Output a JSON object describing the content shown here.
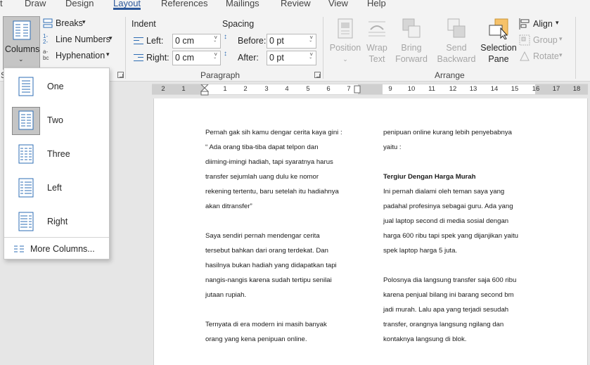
{
  "tabs": [
    "t",
    "Draw",
    "Design",
    "Layout",
    "References",
    "Mailings",
    "Review",
    "View",
    "Help"
  ],
  "active_tab": "Layout",
  "page_setup": {
    "columns_label": "Columns",
    "breaks_label": "Breaks",
    "line_numbers_label": "Line Numbers",
    "hyphenation_label": "Hyphenation",
    "group_fragment": "S"
  },
  "paragraph": {
    "indent_label": "Indent",
    "spacing_label": "Spacing",
    "left_label": "Left:",
    "left_value": "0 cm",
    "right_label": "Right:",
    "right_value": "0 cm",
    "before_label": "Before:",
    "before_value": "0 pt",
    "after_label": "After:",
    "after_value": "0 pt",
    "group_label": "Paragraph"
  },
  "arrange": {
    "position": "Position",
    "wrap_text": [
      "Wrap",
      "Text"
    ],
    "bring_forward": [
      "Bring",
      "Forward"
    ],
    "send_backward": [
      "Send",
      "Backward"
    ],
    "selection_pane": [
      "Selection",
      "Pane"
    ],
    "align": "Align",
    "group": "Group",
    "rotate": "Rotate",
    "group_label": "Arrange"
  },
  "ruler_numbers": [
    "2",
    "1",
    "1",
    "2",
    "3",
    "4",
    "5",
    "6",
    "7",
    "9",
    "10",
    "11",
    "12",
    "13",
    "14",
    "15",
    "16",
    "17",
    "18"
  ],
  "columns_menu": {
    "items": [
      "One",
      "Two",
      "Three",
      "Left",
      "Right"
    ],
    "selected": "Two",
    "more": "More Columns..."
  },
  "document": {
    "column1": [
      "Pernah gak sih kamu dengar cerita kaya gini :",
      "“ Ada orang tiba-tiba dapat telpon dan",
      "diiming-imingi hadiah, tapi syaratnya harus",
      "transfer sejumlah uang dulu ke nomor",
      "rekening tertentu, baru setelah itu hadiahnya",
      "akan ditransfer”",
      "",
      "Saya sendiri pernah mendengar cerita",
      "tersebut bahkan dari orang terdekat. Dan",
      "hasilnya bukan hadiah yang didapatkan tapi",
      "nangis-nangis karena sudah tertipu senilai",
      "jutaan rupiah.",
      "",
      "Ternyata di era modern ini masih banyak",
      "orang yang kena penipuan online."
    ],
    "column2": [
      "penipuan online kurang lebih penyebabnya",
      "yaitu :",
      "",
      "Tergiur Dengan Harga Murah",
      "Ini pernah dialami oleh teman saya yang",
      "padahal profesinya sebagai guru. Ada yang",
      "jual laptop second di media sosial dengan",
      "harga 600 ribu tapi spek yang dijanjikan yaitu",
      "spek laptop harga 5 juta.",
      "",
      "Polosnya dia langsung transfer saja 600 ribu",
      "karena penjual bilang ini barang second bm",
      "jadi murah. Lalu apa yang terjadi sesudah",
      "transfer, orangnya langsung ngilang dan",
      "kontaknya langsung di blok."
    ],
    "column2_bold_line": "Tergiur Dengan Harga Murah"
  },
  "icons": {
    "breaks": "breaks-icon",
    "line_numbers": "line-numbers-icon",
    "hyphenation": "hyphenation-icon",
    "columns": "columns-icon"
  },
  "colors": {
    "accent": "#2b579a",
    "icon_blue": "#2e6db4",
    "selection_pane_orange": "#f6c26a"
  }
}
